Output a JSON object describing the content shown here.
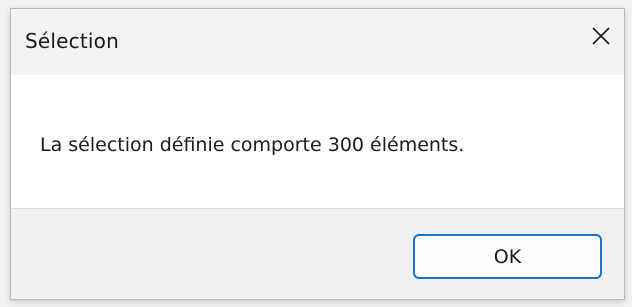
{
  "window": {
    "title": "Sélection",
    "close_icon": "close-icon"
  },
  "dialog": {
    "message": "La sélection définie comporte 300 éléments.",
    "ok_label": "OK"
  },
  "colors": {
    "accent": "#1a73c9",
    "titlebar": "#f3f3f3",
    "content": "#ffffff",
    "footer": "#f0f0f0"
  }
}
